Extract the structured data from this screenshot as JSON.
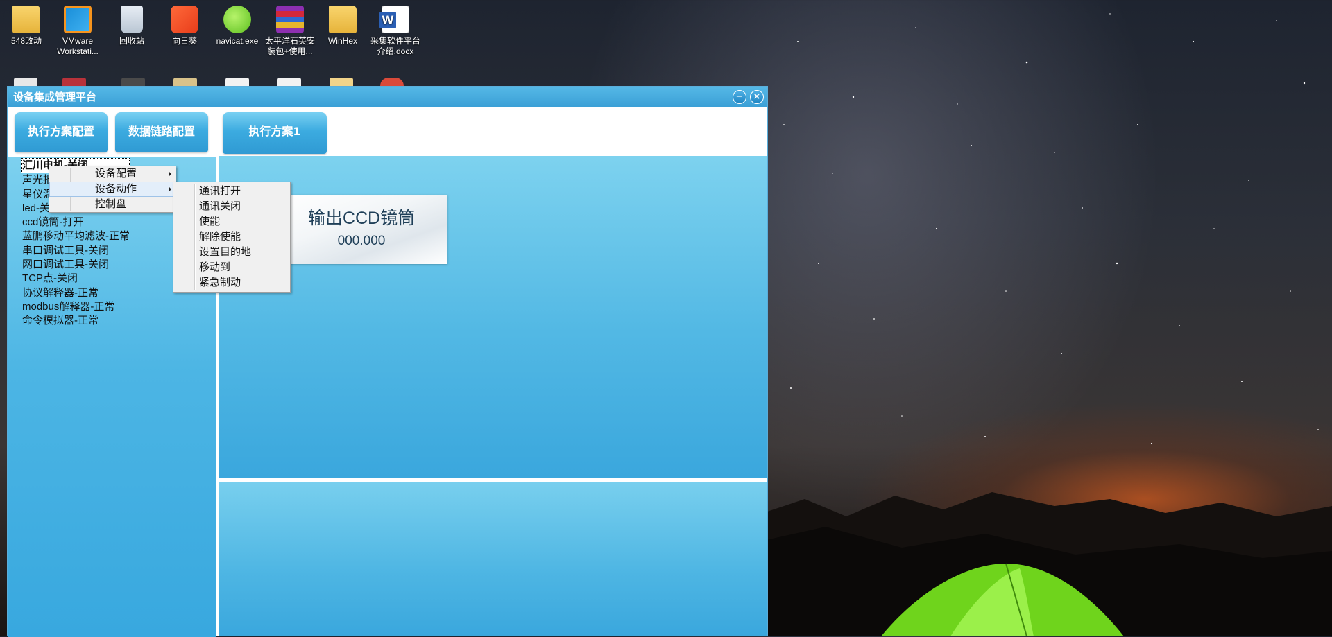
{
  "desktop": {
    "icons": [
      {
        "label": "548改动",
        "icon": "folder-icon"
      },
      {
        "label": "VMware Workstati...",
        "icon": "vmware-icon"
      },
      {
        "label": "回收站",
        "icon": "recycle-bin-icon"
      },
      {
        "label": "向日葵",
        "icon": "sunlogin-icon"
      },
      {
        "label": "navicat.exe",
        "icon": "navicat-icon"
      },
      {
        "label": "太平洋石英安装包+使用...",
        "icon": "winrar-icon"
      },
      {
        "label": "WinHex",
        "icon": "folder-icon"
      },
      {
        "label": "采集软件平台介绍.docx",
        "icon": "word-icon"
      }
    ]
  },
  "window": {
    "title": "设备集成管理平台",
    "minimize_icon": "minimize-icon",
    "close_icon": "close-icon"
  },
  "toolbar": {
    "exec_plan_config": "执行方案配置",
    "data_link_config": "数据链路配置",
    "exec_plan_tab": "执行方案1"
  },
  "device_list": [
    "汇川电机-关闭",
    "声光报警器-关闭",
    "星仪温控器-关闭",
    "led-关闭",
    "ccd镜筒-打开",
    "蓝鹏移动平均滤波-正常",
    "串口调试工具-关闭",
    "网口调试工具-关闭",
    "TCP点-关闭",
    "协议解释器-正常",
    "modbus解释器-正常",
    "命令模拟器-正常"
  ],
  "context_menu": {
    "items": [
      "设备配置",
      "设备动作",
      "控制盘"
    ],
    "highlighted": "设备动作"
  },
  "submenu": {
    "items": [
      "通讯打开",
      "通讯关闭",
      "使能",
      "解除使能",
      "设置目的地",
      "移动到",
      "紧急制动"
    ]
  },
  "device_card": {
    "name": "输出CCD镜筒",
    "value": "000.000"
  }
}
